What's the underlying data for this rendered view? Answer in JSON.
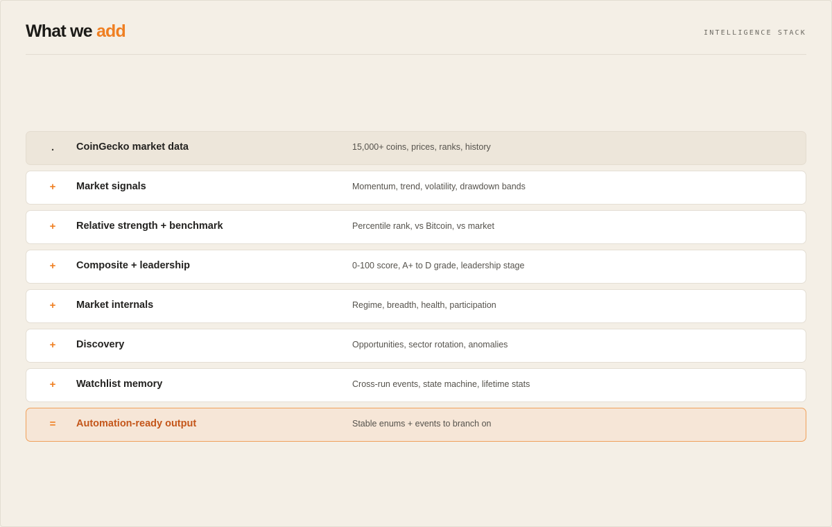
{
  "header": {
    "title_main": "What we",
    "title_accent": "add",
    "eyebrow": "INTELLIGENCE STACK"
  },
  "stack": [
    {
      "symbol": ".",
      "name": "CoinGecko market data",
      "description": "15,000+ coins, prices, ranks, history",
      "kind": "base"
    },
    {
      "symbol": "+",
      "name": "Market signals",
      "description": "Momentum, trend, volatility, drawdown bands",
      "kind": "layer"
    },
    {
      "symbol": "+",
      "name": "Relative strength + benchmark",
      "description": "Percentile rank, vs Bitcoin, vs market",
      "kind": "layer"
    },
    {
      "symbol": "+",
      "name": "Composite + leadership",
      "description": "0-100 score, A+ to D grade, leadership stage",
      "kind": "layer"
    },
    {
      "symbol": "+",
      "name": "Market internals",
      "description": "Regime, breadth, health, participation",
      "kind": "layer"
    },
    {
      "symbol": "+",
      "name": "Discovery",
      "description": "Opportunities, sector rotation, anomalies",
      "kind": "layer"
    },
    {
      "symbol": "+",
      "name": "Watchlist memory",
      "description": "Cross-run events, state machine, lifetime stats",
      "kind": "layer"
    },
    {
      "symbol": "=",
      "name": "Automation-ready output",
      "description": "Stable enums + events to branch on",
      "kind": "result"
    }
  ],
  "colors": {
    "background": "#f4efe6",
    "accent": "#ef7f22",
    "result_text": "#c4561a",
    "result_border": "#f0a05a"
  }
}
